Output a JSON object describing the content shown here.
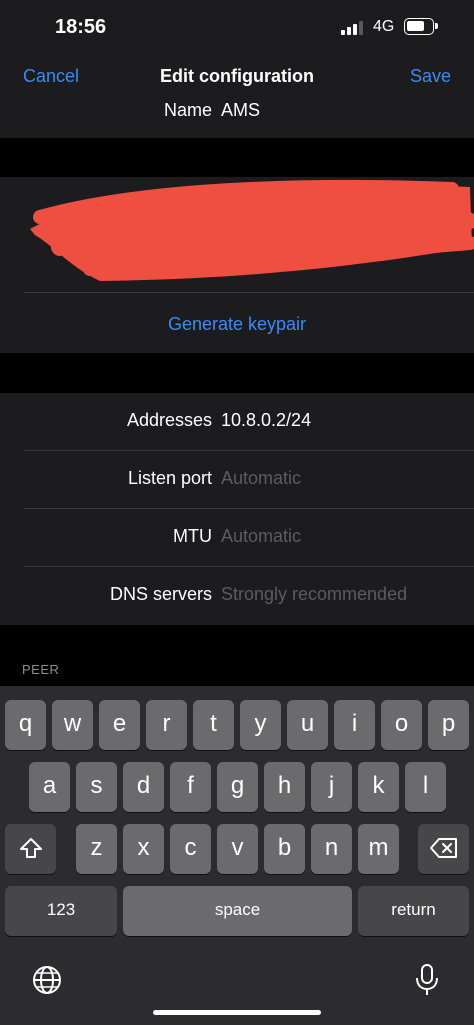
{
  "status_bar": {
    "time": "18:56",
    "network": "4G"
  },
  "nav": {
    "cancel": "Cancel",
    "title": "Edit configuration",
    "save": "Save"
  },
  "interface": {
    "name_label": "Name",
    "name_value": "AMS",
    "generate_keypair": "Generate keypair",
    "addresses_label": "Addresses",
    "addresses_value": "10.8.0.2/24",
    "listen_port_label": "Listen port",
    "listen_port_placeholder": "Automatic",
    "mtu_label": "MTU",
    "mtu_placeholder": "Automatic",
    "dns_label": "DNS servers",
    "dns_placeholder": "Strongly recommended"
  },
  "peer_header": "PEER",
  "keyboard": {
    "row1": [
      "q",
      "w",
      "e",
      "r",
      "t",
      "y",
      "u",
      "i",
      "o",
      "p"
    ],
    "row2": [
      "a",
      "s",
      "d",
      "f",
      "g",
      "h",
      "j",
      "k",
      "l"
    ],
    "row3": [
      "z",
      "x",
      "c",
      "v",
      "b",
      "n",
      "m"
    ],
    "numbers_key": "123",
    "space_key": "space",
    "return_key": "return"
  },
  "colors": {
    "accent": "#3a8bf5",
    "background": "#000000",
    "cell": "#1c1c1e",
    "redaction": "#ef4f40"
  },
  "icons": [
    "shift-icon",
    "backspace-icon",
    "globe-icon",
    "microphone-icon"
  ]
}
